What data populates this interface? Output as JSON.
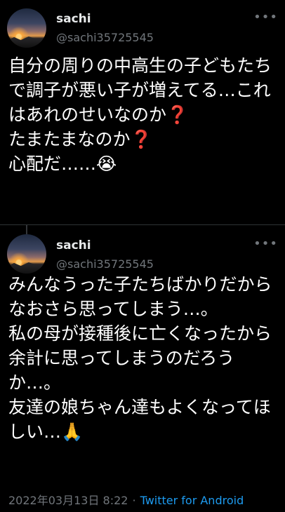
{
  "tweets": [
    {
      "name": "sachi",
      "handle": "@sachi35725545",
      "text": "自分の周りの中高生の子どもたちで調子が悪い子が増えてる…これはあれのせいなのか❓\nたまたまなのか❓\n心配だ……😭",
      "more_icon": "more-icon"
    },
    {
      "name": "sachi",
      "handle": "@sachi35725545",
      "text": "みんなうった子たちばかりだからなおさら思ってしまう…。\n私の母が接種後に亡くなったから余計に思ってしまうのだろうか…。\n友達の娘ちゃん達もよくなってほしい…🙏",
      "more_icon": "more-icon"
    }
  ],
  "meta": {
    "date": "2022年03月13日 8:22",
    "separator": "·",
    "source": "Twitter for Android"
  },
  "colors": {
    "background": "#000000",
    "text": "#ffffff",
    "secondary": "#71767b",
    "link": "#1d9bf0"
  }
}
